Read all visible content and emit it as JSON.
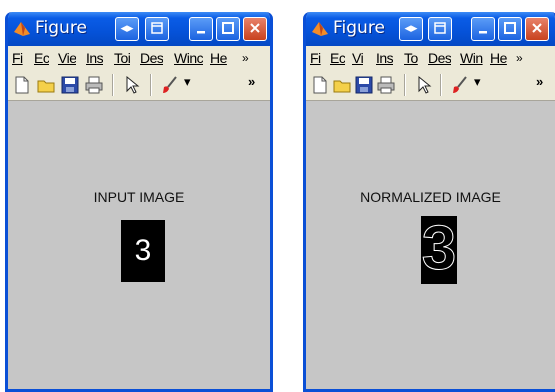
{
  "windows": [
    {
      "title": "Figure",
      "menu": [
        "Fi",
        "Ec",
        "Vie",
        "Ins",
        "Toi",
        "Des",
        "Winc",
        "He"
      ],
      "menu_more": "»",
      "toolbar_more": "»",
      "axes_title": "INPUT IMAGE",
      "image_digit": "3"
    },
    {
      "title": "Figure",
      "menu": [
        "Fi",
        "Ec",
        "Vi",
        "Ins",
        "To",
        "Des",
        "Win",
        "He"
      ],
      "menu_more": "»",
      "toolbar_more": "»",
      "axes_title": "NORMALIZED IMAGE",
      "image_digit": "3"
    }
  ],
  "icons": {
    "app": "matlab-logo-icon",
    "dock": "dock-arrows-icon",
    "undock": "undock-icon",
    "minimize": "minimize-icon",
    "maximize": "maximize-icon",
    "close": "close-icon"
  },
  "colors": {
    "titlebar": "#0552d8",
    "frame": "#0a4fd6",
    "figure_bg": "#c6c6c6",
    "image_bg": "#000000",
    "close_button": "#c8421e"
  }
}
